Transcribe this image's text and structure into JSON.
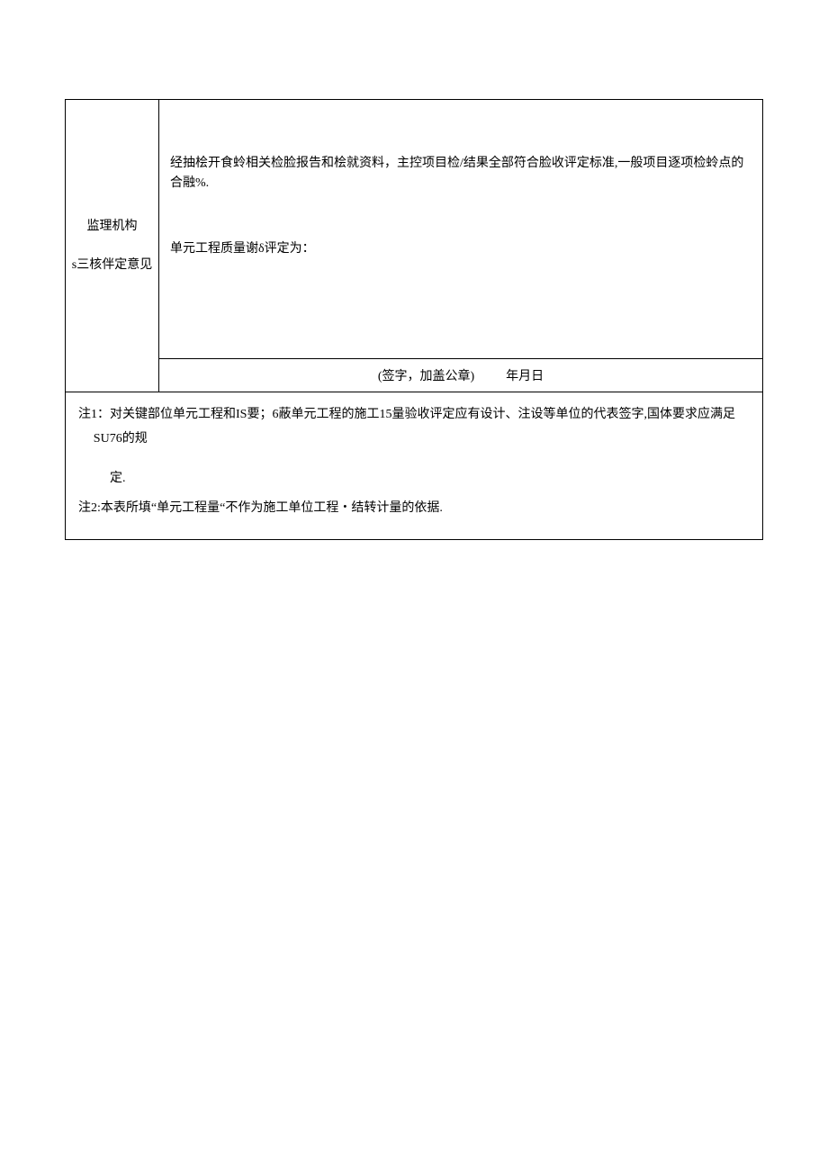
{
  "row1": {
    "leftLabel_line1": "监理机构",
    "leftLabel_line2": "s三核伴定意见",
    "para1": "经抽桧开食蛉相关检脸报告和桧就资料，主控项目检/结果全部符合脸收评定标准,一般项目逐项检蛉点的合融%.",
    "para2": "单元工程质量谢δ评定为：",
    "signature": "(签字，加盖公章)          年月日"
  },
  "notes": {
    "note1_line1": "注1：对关键部位单元工程和IS要；6蔽单元工程的施工15量验收评定应有设计、注设等单位的代表签字,国体要求应满足SU76的规",
    "note1_line2": "定.",
    "note2": "注2:本表所填“单元工程量“不作为施工单位工程・结转计量的依据."
  }
}
